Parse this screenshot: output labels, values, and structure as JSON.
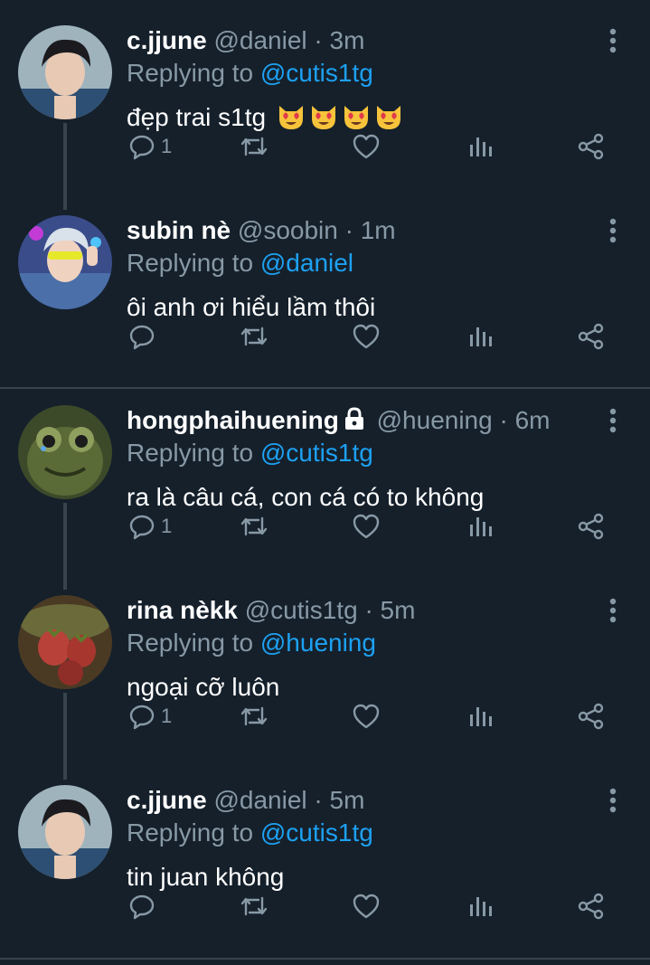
{
  "tweets": [
    {
      "name": "c.jjune",
      "handle": "@daniel",
      "sep": "·",
      "time": "3m",
      "replying_prefix": "Replying to ",
      "replying_to": "@cutis1tg",
      "text": "đẹp trai s1tg",
      "emoji": "heart-eyes-cat-emoji",
      "reply_count": "1",
      "avatar": "avatar-cjjune"
    },
    {
      "name": "subin nè",
      "handle": "@soobin",
      "sep": "·",
      "time": "1m",
      "replying_prefix": "Replying to ",
      "replying_to": "@daniel",
      "text": "ôi anh ơi hiểu lầm thôi",
      "reply_count": "",
      "avatar": "avatar-subin"
    },
    {
      "name": "hongphaihuening",
      "handle": "@huening",
      "sep": "·",
      "time": "6m",
      "replying_prefix": "Replying to ",
      "replying_to": "@cutis1tg",
      "text": "ra là câu cá, con cá có to không",
      "reply_count": "1",
      "locked": true,
      "avatar": "avatar-huening"
    },
    {
      "name": "rina nèkk",
      "handle": "@cutis1tg",
      "sep": "·",
      "time": "5m",
      "replying_prefix": "Replying to ",
      "replying_to": "@huening",
      "text": "ngoại cỡ luôn",
      "reply_count": "1",
      "avatar": "avatar-rina"
    },
    {
      "name": "c.jjune",
      "handle": "@daniel",
      "sep": "·",
      "time": "5m",
      "replying_prefix": "Replying to ",
      "replying_to": "@cutis1tg",
      "text": "tin juan không",
      "reply_count": "",
      "avatar": "avatar-cjjune"
    }
  ],
  "icons": {
    "reply": "reply-icon",
    "retweet": "retweet-icon",
    "like": "heart-icon",
    "analytics": "analytics-icon",
    "share": "share-icon",
    "more": "more-vertical-icon",
    "lock": "lock-icon"
  },
  "colors": {
    "background": "#15202b",
    "secondary_text": "#8899a6",
    "link": "#1da1f2",
    "divider": "#38444d"
  }
}
